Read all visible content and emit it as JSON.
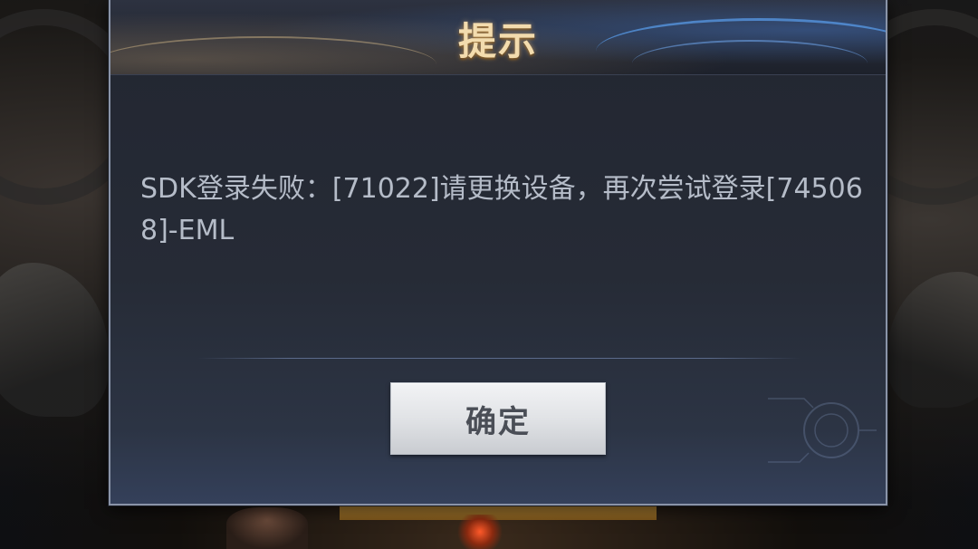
{
  "dialog": {
    "title": "提示",
    "message": "SDK登录失败：[71022]请更换设备，再次尝试登录[745068]-EML",
    "confirm_label": "确定"
  },
  "colors": {
    "title_gold": "#f3dcae",
    "message_text": "#b5bcc8",
    "button_bg": "#e1e3e6",
    "button_text": "#4a4e56",
    "dialog_border": "#8a94a8"
  }
}
